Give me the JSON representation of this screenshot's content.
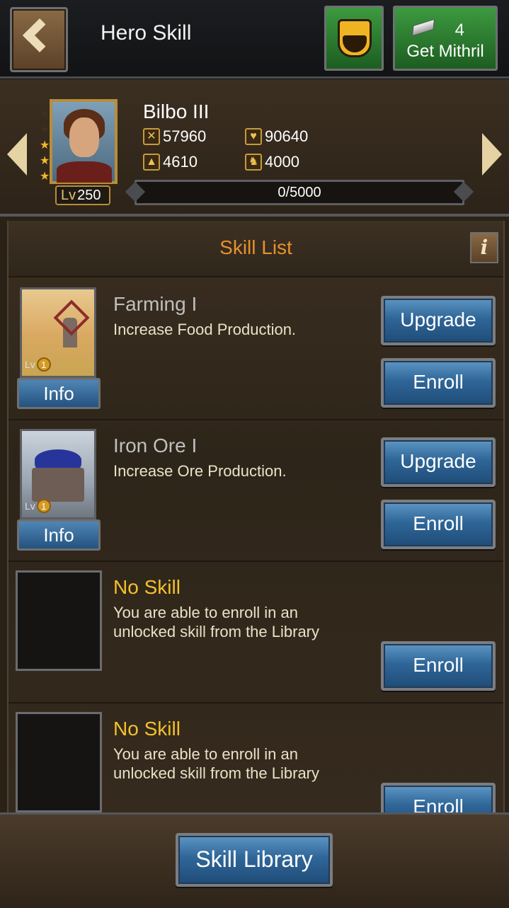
{
  "header": {
    "title": "Hero Skill",
    "mithril_count": "4",
    "mithril_label": "Get Mithril"
  },
  "hero": {
    "name": "Bilbo III",
    "level_prefix": "Lv",
    "level": "250",
    "stars_filled": 3,
    "stars_total": 5,
    "stats": {
      "attack": "57960",
      "health": "90640",
      "defense": "4610",
      "leadership": "4000"
    },
    "xp_text": "0/5000",
    "xp_fraction": 0
  },
  "skill_list": {
    "title": "Skill List",
    "info_icon": "i",
    "items": [
      {
        "name": "Farming I",
        "description": "Increase Food Production.",
        "level_prefix": "Lv",
        "level": "1",
        "info_label": "Info",
        "upgrade_label": "Upgrade",
        "enroll_label": "Enroll",
        "icon": "windmill-icon"
      },
      {
        "name": "Iron Ore I",
        "description": "Increase Ore Production.",
        "level_prefix": "Lv",
        "level": "1",
        "info_label": "Info",
        "upgrade_label": "Upgrade",
        "enroll_label": "Enroll",
        "icon": "ore-cart-icon"
      },
      {
        "name": "No Skill",
        "description": "You are able to enroll in an unlocked skill from the Library",
        "enroll_label": "Enroll"
      },
      {
        "name": "No Skill",
        "description": "You are able to enroll in an unlocked skill from the Library",
        "enroll_label": "Enroll"
      }
    ]
  },
  "footer": {
    "library_label": "Skill Library"
  },
  "colors": {
    "accent_orange": "#e6902d",
    "gold_text": "#f3c12e",
    "button_blue": "#2f6698",
    "button_green": "#2f7d33"
  }
}
